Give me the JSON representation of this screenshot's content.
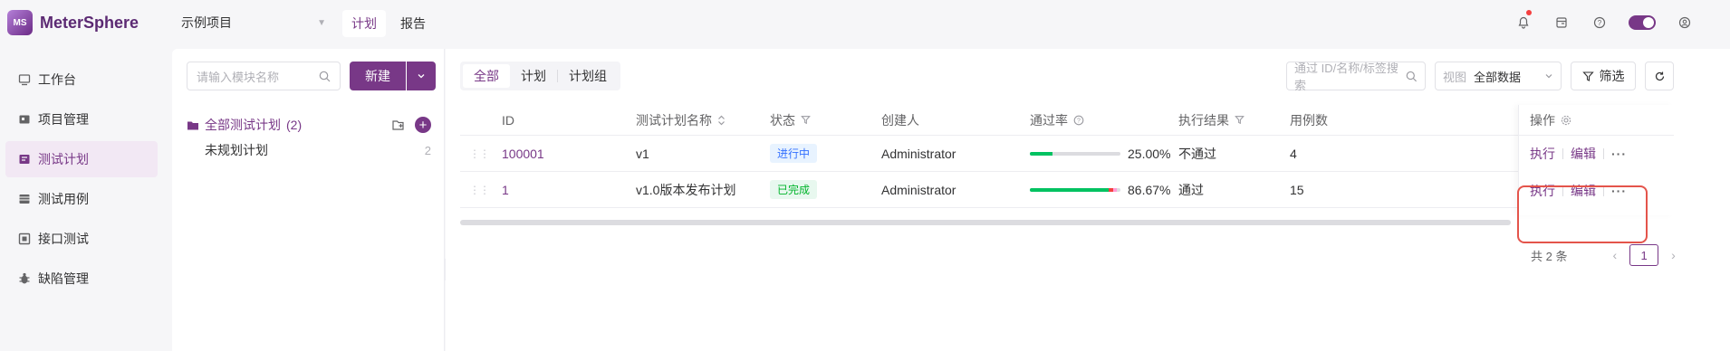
{
  "app": {
    "name": "MeterSphere",
    "logo_text": "MS"
  },
  "header": {
    "project": "示例项目",
    "tabs": [
      {
        "label": "计划",
        "active": true
      },
      {
        "label": "报告",
        "active": false
      }
    ],
    "icons": [
      "bell-icon",
      "task-center-icon",
      "help-icon",
      "theme-toggle",
      "user-settings-icon"
    ]
  },
  "sidebar": {
    "items": [
      {
        "label": "工作台",
        "icon": "workbench-icon",
        "active": false
      },
      {
        "label": "项目管理",
        "icon": "project-icon",
        "active": false
      },
      {
        "label": "测试计划",
        "icon": "test-plan-icon",
        "active": true
      },
      {
        "label": "测试用例",
        "icon": "test-case-icon",
        "active": false
      },
      {
        "label": "接口测试",
        "icon": "api-test-icon",
        "active": false
      },
      {
        "label": "缺陷管理",
        "icon": "bug-icon",
        "active": false
      }
    ]
  },
  "module_panel": {
    "search_placeholder": "请输入模块名称",
    "new_button": "新建",
    "tree": [
      {
        "label": "全部测试计划",
        "count": "(2)",
        "active": true
      },
      {
        "label": "未规划计划",
        "count": "2",
        "active": false
      }
    ]
  },
  "main": {
    "segments": [
      {
        "label": "全部",
        "active": true
      },
      {
        "label": "计划",
        "active": false
      },
      {
        "label": "计划组",
        "active": false
      }
    ],
    "search_placeholder": "通过 ID/名称/标签搜索",
    "view_label": "视图",
    "view_value": "全部数据",
    "filter_button": "筛选",
    "columns": {
      "id": "ID",
      "name": "测试计划名称",
      "status": "状态",
      "creator": "创建人",
      "pass_rate": "通过率",
      "result": "执行结果",
      "case_count": "用例数",
      "operations": "操作"
    },
    "rows": [
      {
        "id": "100001",
        "name": "v1",
        "status": "进行中",
        "status_type": "running",
        "creator": "Administrator",
        "pass_rate": "25.00%",
        "pass_fill": 0.25,
        "fail_fill": 0,
        "block_fill": 0,
        "result": "不通过",
        "case_count": "4",
        "op_execute": "执行",
        "op_edit": "编辑",
        "op_more": "···"
      },
      {
        "id": "1",
        "name": "v1.0版本发布计划",
        "status": "已完成",
        "status_type": "done",
        "creator": "Administrator",
        "pass_rate": "86.67%",
        "pass_fill": 0.8667,
        "fail_fill": 0.05,
        "block_fill": 0.04,
        "result": "通过",
        "case_count": "15",
        "op_execute": "执行",
        "op_edit": "编辑",
        "op_more": "···"
      }
    ],
    "pagination": {
      "total": "共 2 条",
      "current": "1"
    }
  },
  "colors": {
    "brand": "#783887",
    "pass": "#00c261",
    "fail": "#f53f3f",
    "highlight": "#e4544b"
  }
}
